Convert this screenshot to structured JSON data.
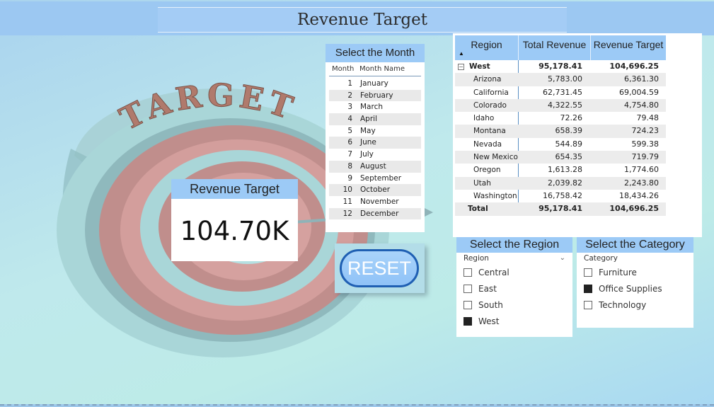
{
  "header": {
    "title": "Revenue Target"
  },
  "target_art": {
    "word": "TARGET"
  },
  "card": {
    "label": "Revenue Target",
    "value": "104.70K"
  },
  "month_slicer": {
    "title": "Select the Month",
    "columns": [
      "Month",
      "Month Name"
    ],
    "rows": [
      {
        "num": "1",
        "name": "January"
      },
      {
        "num": "2",
        "name": "February"
      },
      {
        "num": "3",
        "name": "March"
      },
      {
        "num": "4",
        "name": "April"
      },
      {
        "num": "5",
        "name": "May"
      },
      {
        "num": "6",
        "name": "June"
      },
      {
        "num": "7",
        "name": "July"
      },
      {
        "num": "8",
        "name": "August"
      },
      {
        "num": "9",
        "name": "September"
      },
      {
        "num": "10",
        "name": "October"
      },
      {
        "num": "11",
        "name": "November"
      },
      {
        "num": "12",
        "name": "December"
      }
    ]
  },
  "reset": {
    "label": "RESET"
  },
  "table": {
    "headers": [
      "Region",
      "Total Revenue",
      "Revenue Target"
    ],
    "group": {
      "region": "West",
      "revenue": "95,178.41",
      "target": "104,696.25"
    },
    "rows": [
      {
        "region": "Arizona",
        "revenue": "5,783.00",
        "target": "6,361.30"
      },
      {
        "region": "California",
        "revenue": "62,731.45",
        "target": "69,004.59"
      },
      {
        "region": "Colorado",
        "revenue": "4,322.55",
        "target": "4,754.80"
      },
      {
        "region": "Idaho",
        "revenue": "72.26",
        "target": "79.48"
      },
      {
        "region": "Montana",
        "revenue": "658.39",
        "target": "724.23"
      },
      {
        "region": "Nevada",
        "revenue": "544.89",
        "target": "599.38"
      },
      {
        "region": "New Mexico",
        "revenue": "654.35",
        "target": "719.79"
      },
      {
        "region": "Oregon",
        "revenue": "1,613.28",
        "target": "1,774.60"
      },
      {
        "region": "Utah",
        "revenue": "2,039.82",
        "target": "2,243.80"
      },
      {
        "region": "Washington",
        "revenue": "16,758.42",
        "target": "18,434.26"
      }
    ],
    "total": {
      "region": "Total",
      "revenue": "95,178.41",
      "target": "104,696.25"
    }
  },
  "region_slicer": {
    "title": "Select the Region",
    "field": "Region",
    "options": [
      {
        "label": "Central",
        "checked": false
      },
      {
        "label": "East",
        "checked": false
      },
      {
        "label": "South",
        "checked": false
      },
      {
        "label": "West",
        "checked": true
      }
    ]
  },
  "category_slicer": {
    "title": "Select the Category",
    "field": "Category",
    "options": [
      {
        "label": "Furniture",
        "checked": false
      },
      {
        "label": "Office Supplies",
        "checked": true
      },
      {
        "label": "Technology",
        "checked": false
      }
    ]
  },
  "colors": {
    "header_blue": "#9ccaf6",
    "reset_border": "#1f5fb3",
    "target_red": "#c98a86",
    "target_teal": "#9ec9cc"
  }
}
